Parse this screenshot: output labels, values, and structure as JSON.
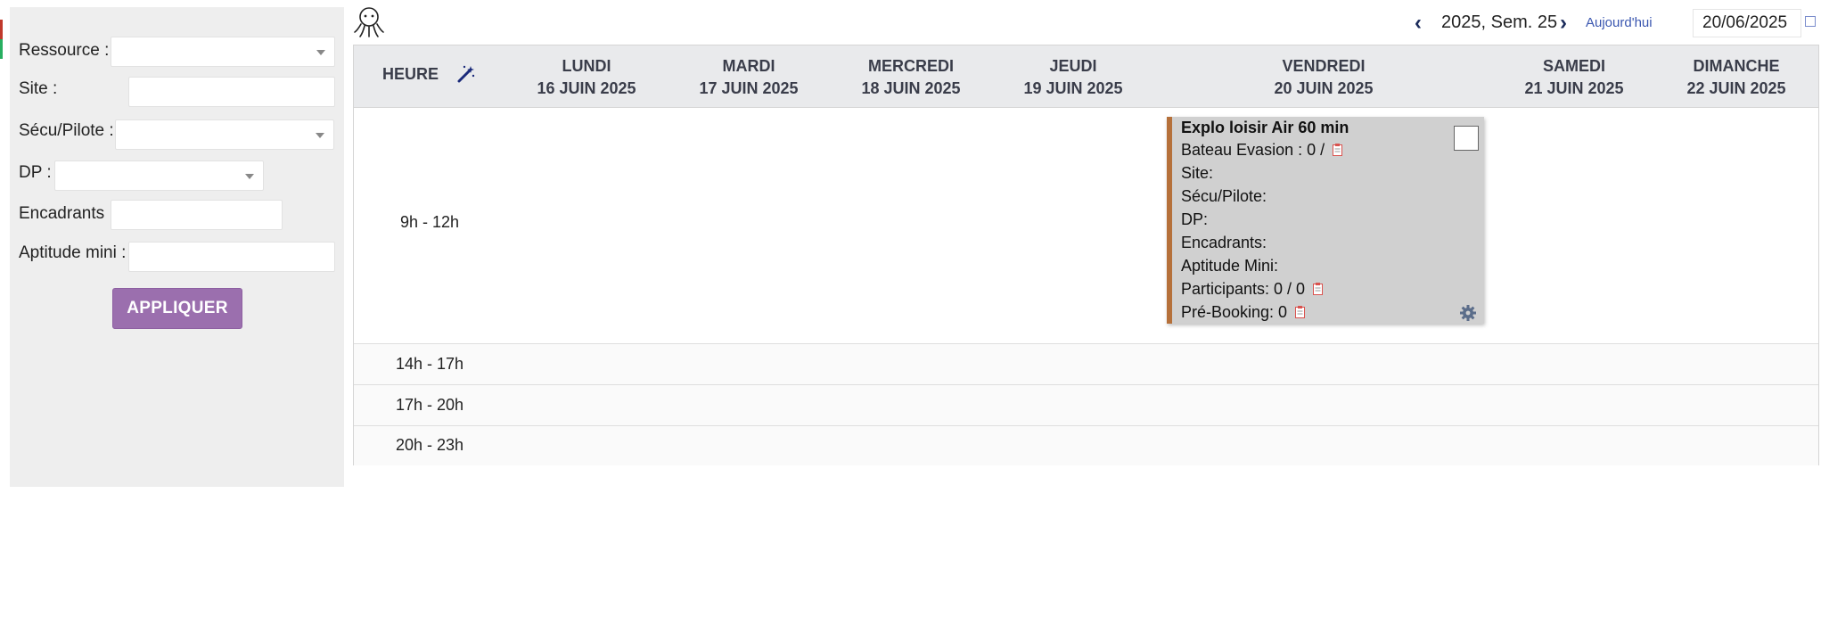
{
  "filters": {
    "ressource_label": "Ressource :",
    "site_label": "Site :",
    "secu_label": "Sécu/Pilote :",
    "dp_label": "DP :",
    "encadrants_label": "Encadrants :",
    "aptitude_label": "Aptitude mini :",
    "apply_label": "APPLIQUER"
  },
  "toolbar": {
    "week_label": "2025, Sem. 25",
    "today_label": "Aujourd'hui",
    "date_value": "20/06/2025"
  },
  "header": {
    "hour_col": "HEURE",
    "days": [
      {
        "name": "LUNDI",
        "date": "16 JUIN 2025"
      },
      {
        "name": "MARDI",
        "date": "17 JUIN 2025"
      },
      {
        "name": "MERCREDI",
        "date": "18 JUIN 2025"
      },
      {
        "name": "JEUDI",
        "date": "19 JUIN 2025"
      },
      {
        "name": "VENDREDI",
        "date": "20 JUIN 2025"
      },
      {
        "name": "SAMEDI",
        "date": "21 JUIN 2025"
      },
      {
        "name": "DIMANCHE",
        "date": "22 JUIN 2025"
      }
    ]
  },
  "slots": [
    "9h - 12h",
    "14h - 17h",
    "17h - 20h",
    "20h - 23h"
  ],
  "event": {
    "title": "Explo loisir Air 60 min",
    "bateau": "Bateau Evasion : 0 /",
    "site": "Site:",
    "secu": "Sécu/Pilote:",
    "dp": "DP:",
    "encadrants": "Encadrants:",
    "aptitude": "Aptitude Mini:",
    "participants": "Participants: 0 / 0",
    "prebooking": "Pré-Booking: 0"
  },
  "colors": {
    "accent_button": "#9b6fae",
    "event_border": "#b5703a",
    "event_bg": "#d0d0d0",
    "header_bg": "#e9eaec",
    "link": "#3b57b0"
  }
}
